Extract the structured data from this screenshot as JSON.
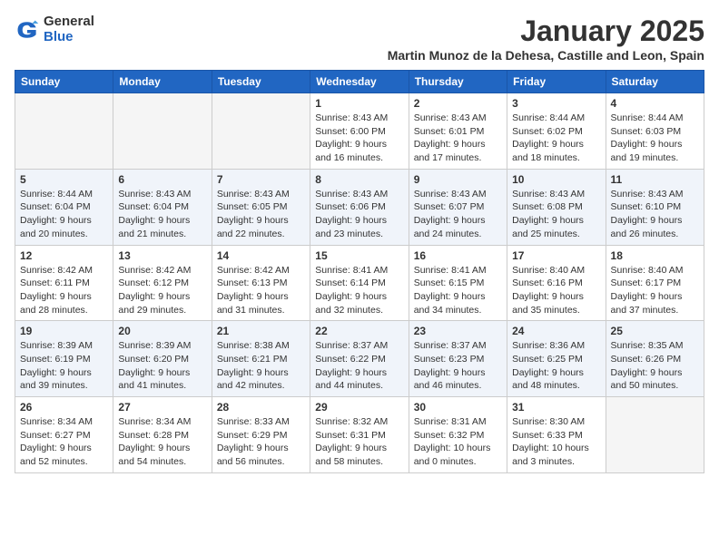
{
  "header": {
    "logo_general": "General",
    "logo_blue": "Blue",
    "month_title": "January 2025",
    "location": "Martin Munoz de la Dehesa, Castille and Leon, Spain"
  },
  "weekdays": [
    "Sunday",
    "Monday",
    "Tuesday",
    "Wednesday",
    "Thursday",
    "Friday",
    "Saturday"
  ],
  "weeks": [
    [
      {
        "day": "",
        "info": ""
      },
      {
        "day": "",
        "info": ""
      },
      {
        "day": "",
        "info": ""
      },
      {
        "day": "1",
        "info": "Sunrise: 8:43 AM\nSunset: 6:00 PM\nDaylight: 9 hours and 16 minutes."
      },
      {
        "day": "2",
        "info": "Sunrise: 8:43 AM\nSunset: 6:01 PM\nDaylight: 9 hours and 17 minutes."
      },
      {
        "day": "3",
        "info": "Sunrise: 8:44 AM\nSunset: 6:02 PM\nDaylight: 9 hours and 18 minutes."
      },
      {
        "day": "4",
        "info": "Sunrise: 8:44 AM\nSunset: 6:03 PM\nDaylight: 9 hours and 19 minutes."
      }
    ],
    [
      {
        "day": "5",
        "info": "Sunrise: 8:44 AM\nSunset: 6:04 PM\nDaylight: 9 hours and 20 minutes."
      },
      {
        "day": "6",
        "info": "Sunrise: 8:43 AM\nSunset: 6:04 PM\nDaylight: 9 hours and 21 minutes."
      },
      {
        "day": "7",
        "info": "Sunrise: 8:43 AM\nSunset: 6:05 PM\nDaylight: 9 hours and 22 minutes."
      },
      {
        "day": "8",
        "info": "Sunrise: 8:43 AM\nSunset: 6:06 PM\nDaylight: 9 hours and 23 minutes."
      },
      {
        "day": "9",
        "info": "Sunrise: 8:43 AM\nSunset: 6:07 PM\nDaylight: 9 hours and 24 minutes."
      },
      {
        "day": "10",
        "info": "Sunrise: 8:43 AM\nSunset: 6:08 PM\nDaylight: 9 hours and 25 minutes."
      },
      {
        "day": "11",
        "info": "Sunrise: 8:43 AM\nSunset: 6:10 PM\nDaylight: 9 hours and 26 minutes."
      }
    ],
    [
      {
        "day": "12",
        "info": "Sunrise: 8:42 AM\nSunset: 6:11 PM\nDaylight: 9 hours and 28 minutes."
      },
      {
        "day": "13",
        "info": "Sunrise: 8:42 AM\nSunset: 6:12 PM\nDaylight: 9 hours and 29 minutes."
      },
      {
        "day": "14",
        "info": "Sunrise: 8:42 AM\nSunset: 6:13 PM\nDaylight: 9 hours and 31 minutes."
      },
      {
        "day": "15",
        "info": "Sunrise: 8:41 AM\nSunset: 6:14 PM\nDaylight: 9 hours and 32 minutes."
      },
      {
        "day": "16",
        "info": "Sunrise: 8:41 AM\nSunset: 6:15 PM\nDaylight: 9 hours and 34 minutes."
      },
      {
        "day": "17",
        "info": "Sunrise: 8:40 AM\nSunset: 6:16 PM\nDaylight: 9 hours and 35 minutes."
      },
      {
        "day": "18",
        "info": "Sunrise: 8:40 AM\nSunset: 6:17 PM\nDaylight: 9 hours and 37 minutes."
      }
    ],
    [
      {
        "day": "19",
        "info": "Sunrise: 8:39 AM\nSunset: 6:19 PM\nDaylight: 9 hours and 39 minutes."
      },
      {
        "day": "20",
        "info": "Sunrise: 8:39 AM\nSunset: 6:20 PM\nDaylight: 9 hours and 41 minutes."
      },
      {
        "day": "21",
        "info": "Sunrise: 8:38 AM\nSunset: 6:21 PM\nDaylight: 9 hours and 42 minutes."
      },
      {
        "day": "22",
        "info": "Sunrise: 8:37 AM\nSunset: 6:22 PM\nDaylight: 9 hours and 44 minutes."
      },
      {
        "day": "23",
        "info": "Sunrise: 8:37 AM\nSunset: 6:23 PM\nDaylight: 9 hours and 46 minutes."
      },
      {
        "day": "24",
        "info": "Sunrise: 8:36 AM\nSunset: 6:25 PM\nDaylight: 9 hours and 48 minutes."
      },
      {
        "day": "25",
        "info": "Sunrise: 8:35 AM\nSunset: 6:26 PM\nDaylight: 9 hours and 50 minutes."
      }
    ],
    [
      {
        "day": "26",
        "info": "Sunrise: 8:34 AM\nSunset: 6:27 PM\nDaylight: 9 hours and 52 minutes."
      },
      {
        "day": "27",
        "info": "Sunrise: 8:34 AM\nSunset: 6:28 PM\nDaylight: 9 hours and 54 minutes."
      },
      {
        "day": "28",
        "info": "Sunrise: 8:33 AM\nSunset: 6:29 PM\nDaylight: 9 hours and 56 minutes."
      },
      {
        "day": "29",
        "info": "Sunrise: 8:32 AM\nSunset: 6:31 PM\nDaylight: 9 hours and 58 minutes."
      },
      {
        "day": "30",
        "info": "Sunrise: 8:31 AM\nSunset: 6:32 PM\nDaylight: 10 hours and 0 minutes."
      },
      {
        "day": "31",
        "info": "Sunrise: 8:30 AM\nSunset: 6:33 PM\nDaylight: 10 hours and 3 minutes."
      },
      {
        "day": "",
        "info": ""
      }
    ]
  ]
}
